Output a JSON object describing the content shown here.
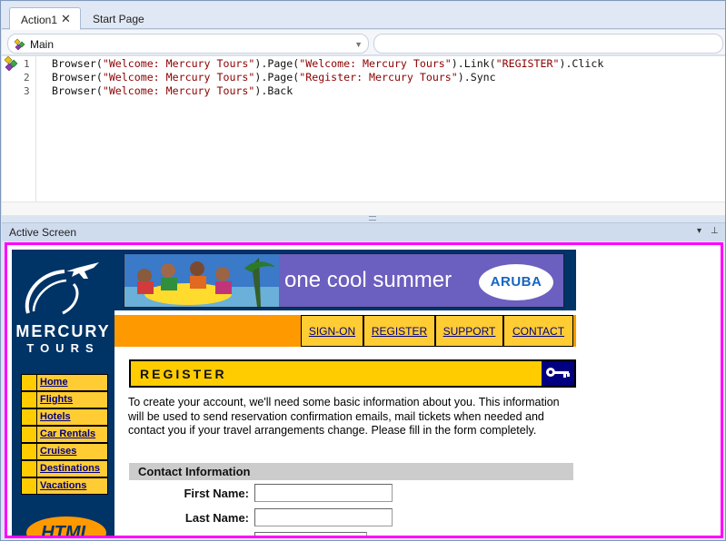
{
  "tabs": [
    {
      "label": "Action1",
      "active": true
    },
    {
      "label": "Start Page",
      "active": false
    }
  ],
  "procedure": {
    "selected": "Main"
  },
  "code": {
    "lines": [
      {
        "number": "1",
        "parts": [
          "Browser(",
          "\"Welcome: Mercury Tours\"",
          ").Page(",
          "\"Welcome: Mercury Tours\"",
          ").Link(",
          "\"REGISTER\"",
          ").Click"
        ]
      },
      {
        "number": "2",
        "parts": [
          "Browser(",
          "\"Welcome: Mercury Tours\"",
          ").Page(",
          "\"Register: Mercury Tours\"",
          ").Sync"
        ]
      },
      {
        "number": "3",
        "parts": [
          "Browser(",
          "\"Welcome: Mercury Tours\"",
          ").Back"
        ]
      }
    ]
  },
  "pane": {
    "title": "Active Screen"
  },
  "site": {
    "brand_top": "MERCURY",
    "brand_bottom": "TOURS",
    "banner_text": "one cool summer",
    "banner_logo": "ARUBA",
    "top_nav": [
      "SIGN-ON",
      "REGISTER",
      "SUPPORT",
      "CONTACT"
    ],
    "side_nav": [
      "Home",
      "Flights",
      "Hotels",
      "Car Rentals",
      "Cruises",
      "Destinations",
      "Vacations"
    ],
    "badge_text": "HTML",
    "register_title": "REGISTER",
    "intro": "To create your account, we'll need some basic information about you. This information will be used to send reservation confirmation emails, mail tickets when needed and contact you if your travel arrangements change. Please fill in the form completely.",
    "section_title": "Contact Information",
    "fields": [
      {
        "label": "First Name:",
        "value": ""
      },
      {
        "label": "Last Name:",
        "value": ""
      }
    ]
  },
  "colors": {
    "highlight_border": "#ff00ff",
    "site_navy": "#003366",
    "site_yellow": "#ffcc00",
    "site_orange": "#ff9900"
  }
}
